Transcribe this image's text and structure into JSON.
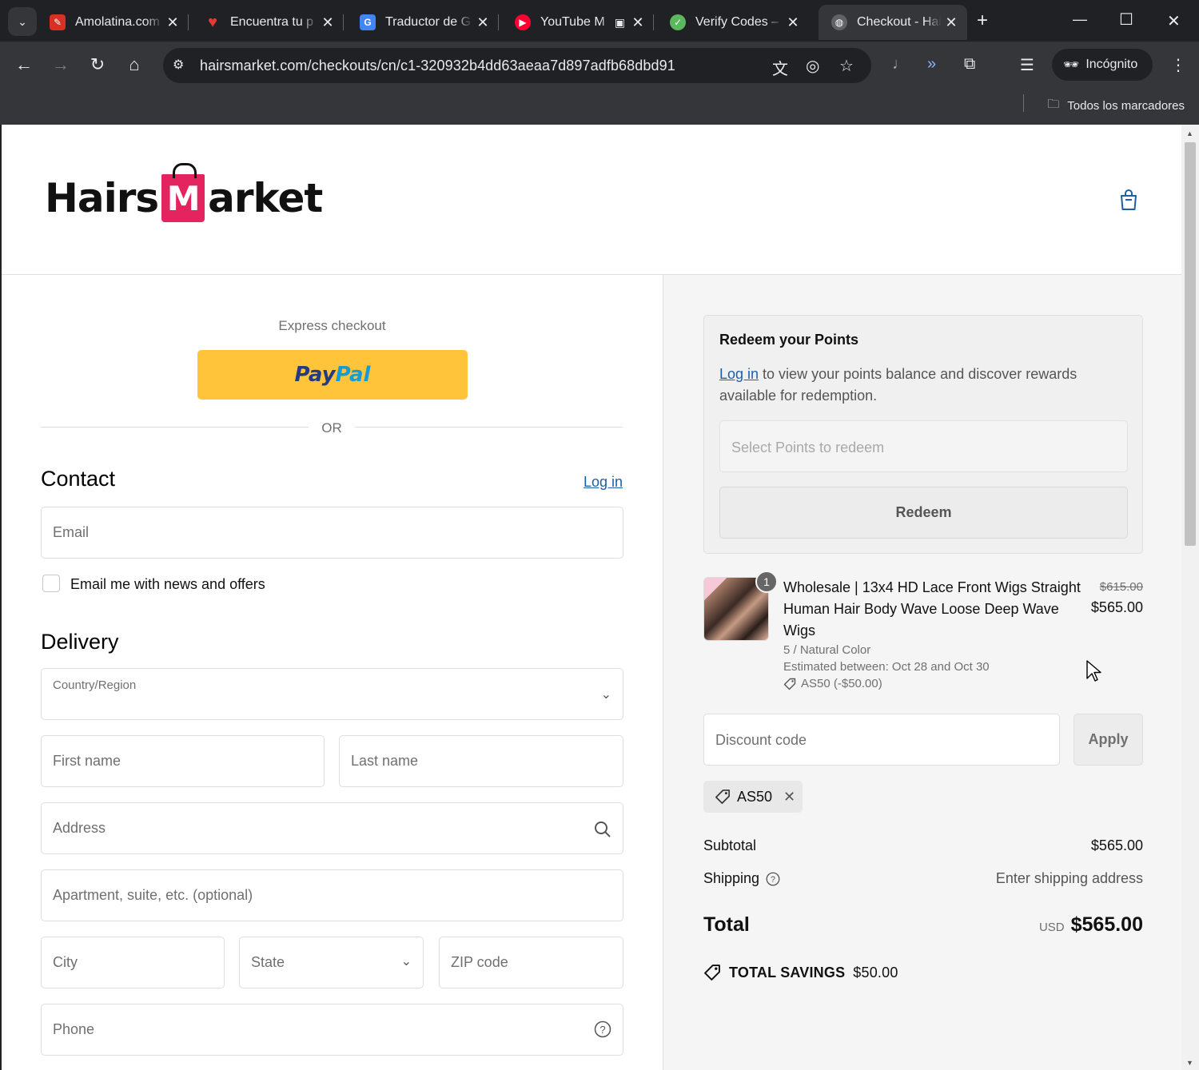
{
  "browser": {
    "tabs": [
      {
        "title": "Amolatina.com",
        "icon": "amolatina-favicon",
        "color": "#d93025"
      },
      {
        "title": "Encuentra tu p",
        "icon": "heart-favicon",
        "color": "#e53935"
      },
      {
        "title": "Traductor de G",
        "icon": "google-translate-favicon",
        "color": "#4285f4"
      },
      {
        "title": "YouTube M",
        "icon": "youtube-music-favicon",
        "color": "#ff0033"
      },
      {
        "title": "Verify Codes –",
        "icon": "verify-codes-favicon",
        "color": "#5cb85c"
      },
      {
        "title": "Checkout - Hai",
        "icon": "globe-favicon",
        "color": "#5f6368",
        "active": true
      }
    ],
    "url": "hairsmarket.com/checkouts/cn/c1-320932b4dd63aeaa7d897adfb68dbd91",
    "incognito_label": "Incógnito",
    "bookmarks_label": "Todos los marcadores"
  },
  "store": {
    "logo_left": "Hairs",
    "logo_mark": "M",
    "logo_right": "arket",
    "brand_color": "#e3245e"
  },
  "checkout": {
    "express_label": "Express checkout",
    "paypal_part1": "Pay",
    "paypal_part2": "Pal",
    "or_label": "OR",
    "contact_heading": "Contact",
    "login_link": "Log in",
    "email_placeholder": "Email",
    "newsletter_label": "Email me with news and offers",
    "delivery_heading": "Delivery",
    "country_label": "Country/Region",
    "first_name": "First name",
    "last_name": "Last name",
    "address": "Address",
    "apartment": "Apartment, suite, etc. (optional)",
    "city": "City",
    "state": "State",
    "zip": "ZIP code",
    "phone": "Phone"
  },
  "summary": {
    "points_title": "Redeem your Points",
    "points_login": "Log in",
    "points_desc": " to view your points balance and discover rewards available for redemption.",
    "points_select_placeholder": "Select Points to redeem",
    "redeem_button": "Redeem",
    "product": {
      "quantity": "1",
      "title": "Wholesale | 13x4 HD Lace Front Wigs Straight Human Hair Body Wave Loose Deep Wave Wigs",
      "variant": "5 / Natural Color",
      "estimate": "Estimated between: Oct 28 and Oct 30",
      "discount": "AS50 (-$50.00)",
      "old_price": "$615.00",
      "price": "$565.00"
    },
    "discount_placeholder": "Discount code",
    "apply_button": "Apply",
    "applied_code": "AS50",
    "subtotal_label": "Subtotal",
    "subtotal_value": "$565.00",
    "shipping_label": "Shipping",
    "shipping_value": "Enter shipping address",
    "total_label": "Total",
    "total_currency": "USD",
    "total_value": "$565.00",
    "savings_label": "TOTAL SAVINGS",
    "savings_value": "$50.00"
  }
}
